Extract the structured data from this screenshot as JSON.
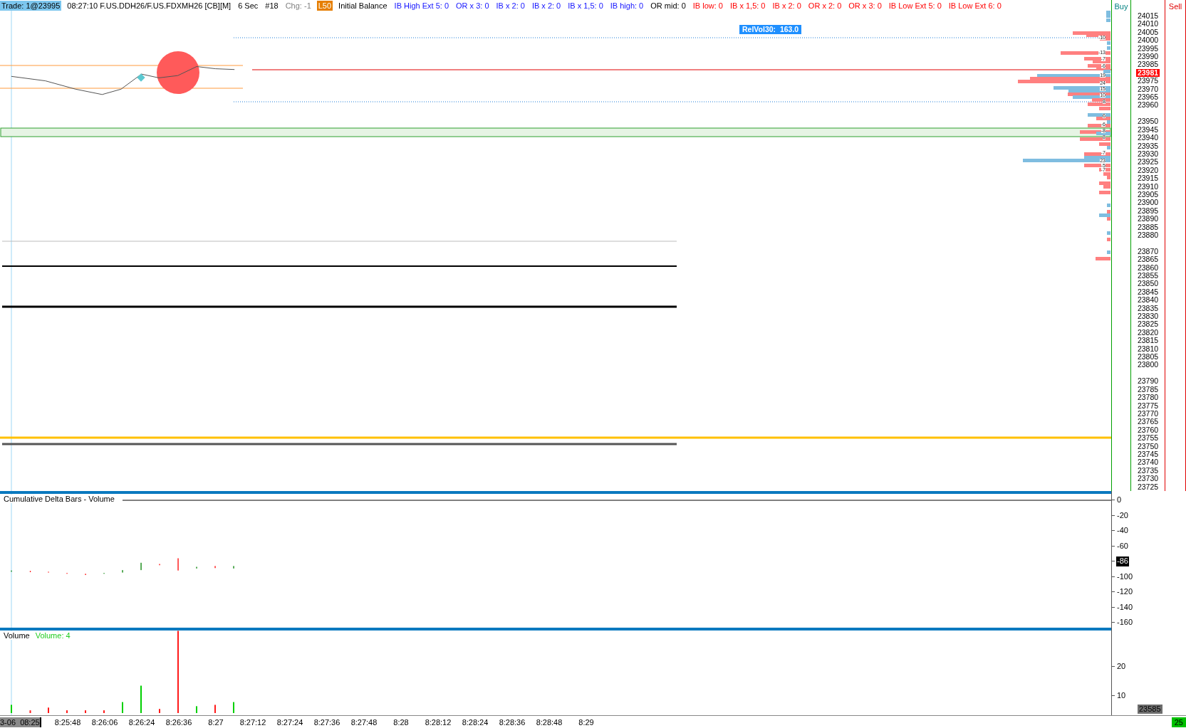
{
  "header": [
    {
      "text": "Trade: 1@23995",
      "kind": "highlight"
    },
    {
      "text": "08:27:10 F.US.DDH26/F.US.FDXMH26 [CB][M]",
      "kind": "neutral"
    },
    {
      "text": "6 Sec",
      "kind": "neutral"
    },
    {
      "text": "#18",
      "kind": "neutral"
    },
    {
      "text": "Chg: -1",
      "kind": "muted"
    },
    {
      "text": "L50",
      "kind": "tag"
    },
    {
      "text": "Initial Balance",
      "kind": "neutral"
    },
    {
      "text": "IB High Ext 5: 0",
      "kind": "upper"
    },
    {
      "text": "OR x 3: 0",
      "kind": "upper"
    },
    {
      "text": "IB x 2: 0",
      "kind": "upper"
    },
    {
      "text": "IB x 2: 0",
      "kind": "upper"
    },
    {
      "text": "IB x 1,5: 0",
      "kind": "upper"
    },
    {
      "text": "IB high: 0",
      "kind": "upper"
    },
    {
      "text": "OR mid: 0",
      "kind": "neutral"
    },
    {
      "text": "IB low: 0",
      "kind": "lower"
    },
    {
      "text": "IB x 1,5: 0",
      "kind": "lower"
    },
    {
      "text": "IB x 2: 0",
      "kind": "lower"
    },
    {
      "text": "OR x 2: 0",
      "kind": "lower"
    },
    {
      "text": "OR x 3: 0",
      "kind": "lower"
    },
    {
      "text": "IB Low Ext 5: 0",
      "kind": "lower"
    },
    {
      "text": "IB Low Ext 6: 0",
      "kind": "lower"
    }
  ],
  "price_chart": {
    "relvol_label": "RelVol30:  163.0",
    "profile_labels": [
      "-10",
      "-13",
      "-7",
      "-6",
      "19",
      "24",
      "15",
      "10",
      "8",
      "6",
      "-6",
      "-8",
      "8",
      "-7",
      "23",
      "-5",
      "-7"
    ]
  },
  "price_axis": {
    "buy_label": "Buy",
    "sell_label": "Sell",
    "groups": [
      [
        {
          "text": "24015",
          "current": false
        },
        {
          "text": "24010",
          "current": false
        },
        {
          "text": "24005",
          "current": false
        },
        {
          "text": "24000",
          "current": false
        },
        {
          "text": "23995",
          "current": false
        },
        {
          "text": "23990",
          "current": false
        },
        {
          "text": "23985",
          "current": false
        },
        {
          "text": "23981",
          "current": true
        },
        {
          "text": "23975",
          "current": false
        },
        {
          "text": "23970",
          "current": false
        },
        {
          "text": "23965",
          "current": false
        },
        {
          "text": "23960",
          "current": false
        }
      ],
      [
        {
          "text": "23950",
          "current": false
        },
        {
          "text": "23945",
          "current": false
        },
        {
          "text": "23940",
          "current": false
        },
        {
          "text": "23935",
          "current": false
        },
        {
          "text": "23930",
          "current": false
        },
        {
          "text": "23925",
          "current": false
        },
        {
          "text": "23920",
          "current": false
        },
        {
          "text": "23915",
          "current": false
        },
        {
          "text": "23910",
          "current": false
        },
        {
          "text": "23905",
          "current": false
        },
        {
          "text": "23900",
          "current": false
        },
        {
          "text": "23895",
          "current": false
        },
        {
          "text": "23890",
          "current": false
        },
        {
          "text": "23885",
          "current": false
        },
        {
          "text": "23880",
          "current": false
        }
      ],
      [
        {
          "text": "23870",
          "current": false
        },
        {
          "text": "23865",
          "current": false
        },
        {
          "text": "23860",
          "current": false
        },
        {
          "text": "23855",
          "current": false
        },
        {
          "text": "23850",
          "current": false
        },
        {
          "text": "23845",
          "current": false
        },
        {
          "text": "23840",
          "current": false
        },
        {
          "text": "23835",
          "current": false
        },
        {
          "text": "23830",
          "current": false
        },
        {
          "text": "23825",
          "current": false
        },
        {
          "text": "23820",
          "current": false
        },
        {
          "text": "23815",
          "current": false
        },
        {
          "text": "23810",
          "current": false
        },
        {
          "text": "23805",
          "current": false
        },
        {
          "text": "23800",
          "current": false
        }
      ],
      [
        {
          "text": "23790",
          "current": false
        },
        {
          "text": "23785",
          "current": false
        },
        {
          "text": "23780",
          "current": false
        },
        {
          "text": "23775",
          "current": false
        },
        {
          "text": "23770",
          "current": false
        },
        {
          "text": "23765",
          "current": false
        },
        {
          "text": "23760",
          "current": false
        },
        {
          "text": "23755",
          "current": false
        },
        {
          "text": "23750",
          "current": false
        },
        {
          "text": "23745",
          "current": false
        },
        {
          "text": "23740",
          "current": false
        },
        {
          "text": "23735",
          "current": false
        },
        {
          "text": "23730",
          "current": false
        },
        {
          "text": "23725",
          "current": false
        }
      ]
    ]
  },
  "delta_pane": {
    "title": "Cumulative Delta Bars - Volume",
    "axis_labels": [
      {
        "text": "0",
        "current": false
      },
      {
        "text": "-20",
        "current": false
      },
      {
        "text": "-40",
        "current": false
      },
      {
        "text": "-60",
        "current": false
      },
      {
        "text": "-86",
        "current": true
      },
      {
        "text": "-100",
        "current": false
      },
      {
        "text": "-120",
        "current": false
      },
      {
        "text": "-140",
        "current": false
      },
      {
        "text": "-160",
        "current": false
      }
    ]
  },
  "volume_pane": {
    "title": "Volume",
    "reading": "Volume: 4",
    "axis_labels": [
      "20",
      "10"
    ]
  },
  "time_axis": {
    "date_label": "3-06  08:25",
    "labels": [
      "8:25:48",
      "8:26:06",
      "8:26:24",
      "8:26:36",
      "8:27",
      "8:27:12",
      "8:27:24",
      "8:27:36",
      "8:27:48",
      "8:28",
      "8:28:12",
      "8:28:24",
      "8:28:36",
      "8:28:48",
      "8:29"
    ]
  },
  "status": {
    "last_price": "23585",
    "count": "25"
  }
}
